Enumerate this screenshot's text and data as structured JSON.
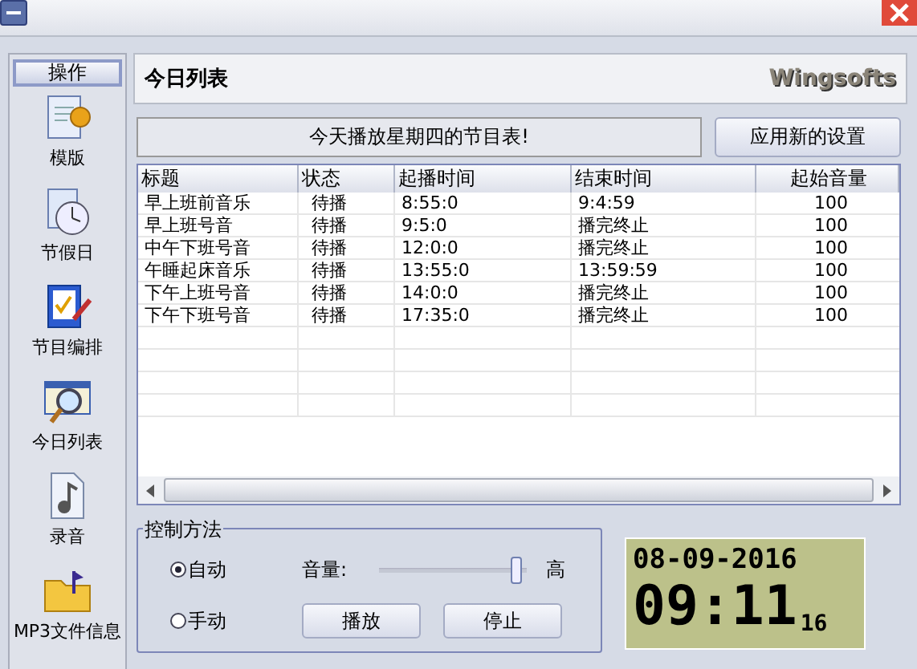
{
  "sidebar": {
    "header": "操作",
    "items": [
      {
        "label": "模版",
        "kind": "template"
      },
      {
        "label": "节假日",
        "kind": "holiday"
      },
      {
        "label": "节目编排",
        "kind": "schedule"
      },
      {
        "label": "今日列表",
        "kind": "today"
      },
      {
        "label": "录音",
        "kind": "record"
      },
      {
        "label": "MP3文件信息",
        "kind": "mp3"
      }
    ]
  },
  "header": {
    "title": "今日列表",
    "brand": "Wingsofts"
  },
  "banner": "今天播放星期四的节目表!",
  "apply_button": "应用新的设置",
  "table": {
    "columns": [
      "标题",
      "状态",
      "起播时间",
      "结束时间",
      "起始音量"
    ],
    "rows": [
      [
        "早上班前音乐",
        "待播",
        "8:55:0",
        "9:4:59",
        "100"
      ],
      [
        "早上班号音",
        "待播",
        "9:5:0",
        "播完终止",
        "100"
      ],
      [
        "中午下班号音",
        "待播",
        "12:0:0",
        "播完终止",
        "100"
      ],
      [
        "午睡起床音乐",
        "待播",
        "13:55:0",
        "13:59:59",
        "100"
      ],
      [
        "下午上班号音",
        "待播",
        "14:0:0",
        "播完终止",
        "100"
      ],
      [
        "下午下班号音",
        "待播",
        "17:35:0",
        "播完终止",
        "100"
      ]
    ]
  },
  "control": {
    "title": "控制方法",
    "modes": [
      {
        "label": "自动",
        "selected": true
      },
      {
        "label": "手动",
        "selected": false
      }
    ],
    "volume_label": "音量:",
    "volume": {
      "level": 0.95
    },
    "volume_high": "高",
    "buttons": [
      "播放",
      "停止"
    ]
  },
  "clock": {
    "date": "08-09-2016",
    "time": "09:11",
    "seconds": "16"
  }
}
